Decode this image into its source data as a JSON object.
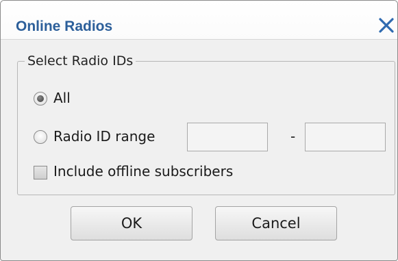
{
  "window": {
    "title": "Online Radios",
    "close_icon": "close-x-icon"
  },
  "group": {
    "legend": "Select Radio IDs"
  },
  "options": {
    "all_label": "All",
    "all_selected": true,
    "range_label": "Radio ID range",
    "range_selected": false,
    "range_from_value": "",
    "range_to_value": "",
    "range_separator": "-",
    "include_offline_label": "Include offline subscribers",
    "include_offline_checked": false
  },
  "buttons": {
    "ok_label": "OK",
    "cancel_label": "Cancel"
  },
  "colors": {
    "title": "#2c5f9a",
    "close_icon": "#2f6ab0"
  }
}
